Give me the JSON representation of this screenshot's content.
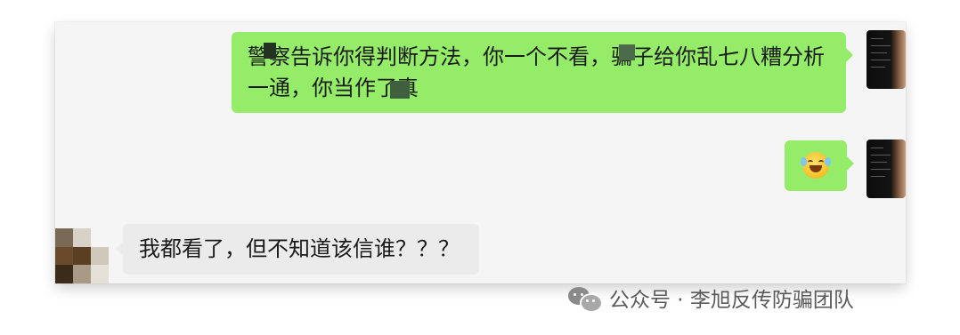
{
  "messages": [
    {
      "side": "right",
      "line1": "警察告诉你得判断方法，你一个不看，骗子给你乱七八糟分析",
      "line2": "一通，你当作了真"
    },
    {
      "side": "right",
      "emoji": "face-with-tears-of-joy-icon"
    },
    {
      "side": "left",
      "text": "我都看了，但不知道该信谁？？？"
    }
  ],
  "watermark": {
    "icon": "wechat-icon",
    "text": "公众号 · 李旭反传防骗团队"
  },
  "colors": {
    "outgoing_bubble": "#95ec69",
    "incoming_bubble": "#ebebeb",
    "chat_background": "#f5f5f5"
  }
}
